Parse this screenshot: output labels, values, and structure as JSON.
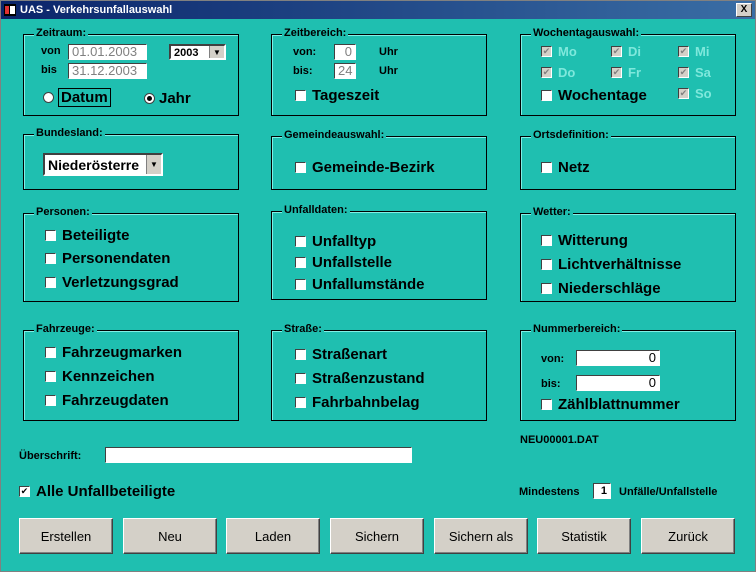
{
  "window": {
    "title": "UAS - Verkehrsunfallauswahl",
    "close": "X"
  },
  "zeitraum": {
    "label": "Zeitraum:",
    "von_label": "von",
    "von": "01.01.2003",
    "bis_label": "bis",
    "bis": "31.12.2003",
    "year": "2003",
    "datum": "Datum",
    "jahr": "Jahr",
    "selected": "Jahr"
  },
  "zeitbereich": {
    "label": "Zeitbereich:",
    "von_label": "von:",
    "von": "0",
    "bis_label": "bis:",
    "bis": "24",
    "unit": "Uhr",
    "tageszeit": "Tageszeit"
  },
  "wochentag": {
    "label": "Wochentagauswahl:",
    "days": [
      "Mo",
      "Di",
      "Mi",
      "Do",
      "Fr",
      "Sa",
      "So"
    ],
    "wochentage": "Wochentage"
  },
  "bundesland": {
    "label": "Bundesland:",
    "value": "Niederösterre"
  },
  "gemeinde": {
    "label": "Gemeindeauswahl:",
    "item": "Gemeinde-Bezirk"
  },
  "orts": {
    "label": "Ortsdefinition:",
    "item": "Netz"
  },
  "personen": {
    "label": "Personen:",
    "items": [
      "Beteiligte",
      "Personendaten",
      "Verletzungsgrad"
    ]
  },
  "unfall": {
    "label": "Unfalldaten:",
    "items": [
      "Unfalltyp",
      "Unfallstelle",
      "Unfallumstände"
    ]
  },
  "wetter": {
    "label": "Wetter:",
    "items": [
      "Witterung",
      "Lichtverhältnisse",
      "Niederschläge"
    ]
  },
  "fahrzeuge": {
    "label": "Fahrzeuge:",
    "items": [
      "Fahrzeugmarken",
      "Kennzeichen",
      "Fahrzeugdaten"
    ]
  },
  "strasse": {
    "label": "Straße:",
    "items": [
      "Straßenart",
      "Straßenzustand",
      "Fahrbahnbelag"
    ]
  },
  "nummer": {
    "label": "Nummerbereich:",
    "von_label": "von:",
    "von": "0",
    "bis_label": "bis:",
    "bis": "0",
    "item": "Zählblattnummer"
  },
  "file": "NEU00001.DAT",
  "ueberschrift": {
    "label": "Überschrift:",
    "value": ""
  },
  "alle": "Alle Unfallbeteiligte",
  "mindestens": {
    "label": "Mindestens",
    "value": "1",
    "suffix": "Unfälle/Unfallstelle"
  },
  "buttons": [
    "Erstellen",
    "Neu",
    "Laden",
    "Sichern",
    "Sichern als",
    "Statistik",
    "Zurück"
  ]
}
